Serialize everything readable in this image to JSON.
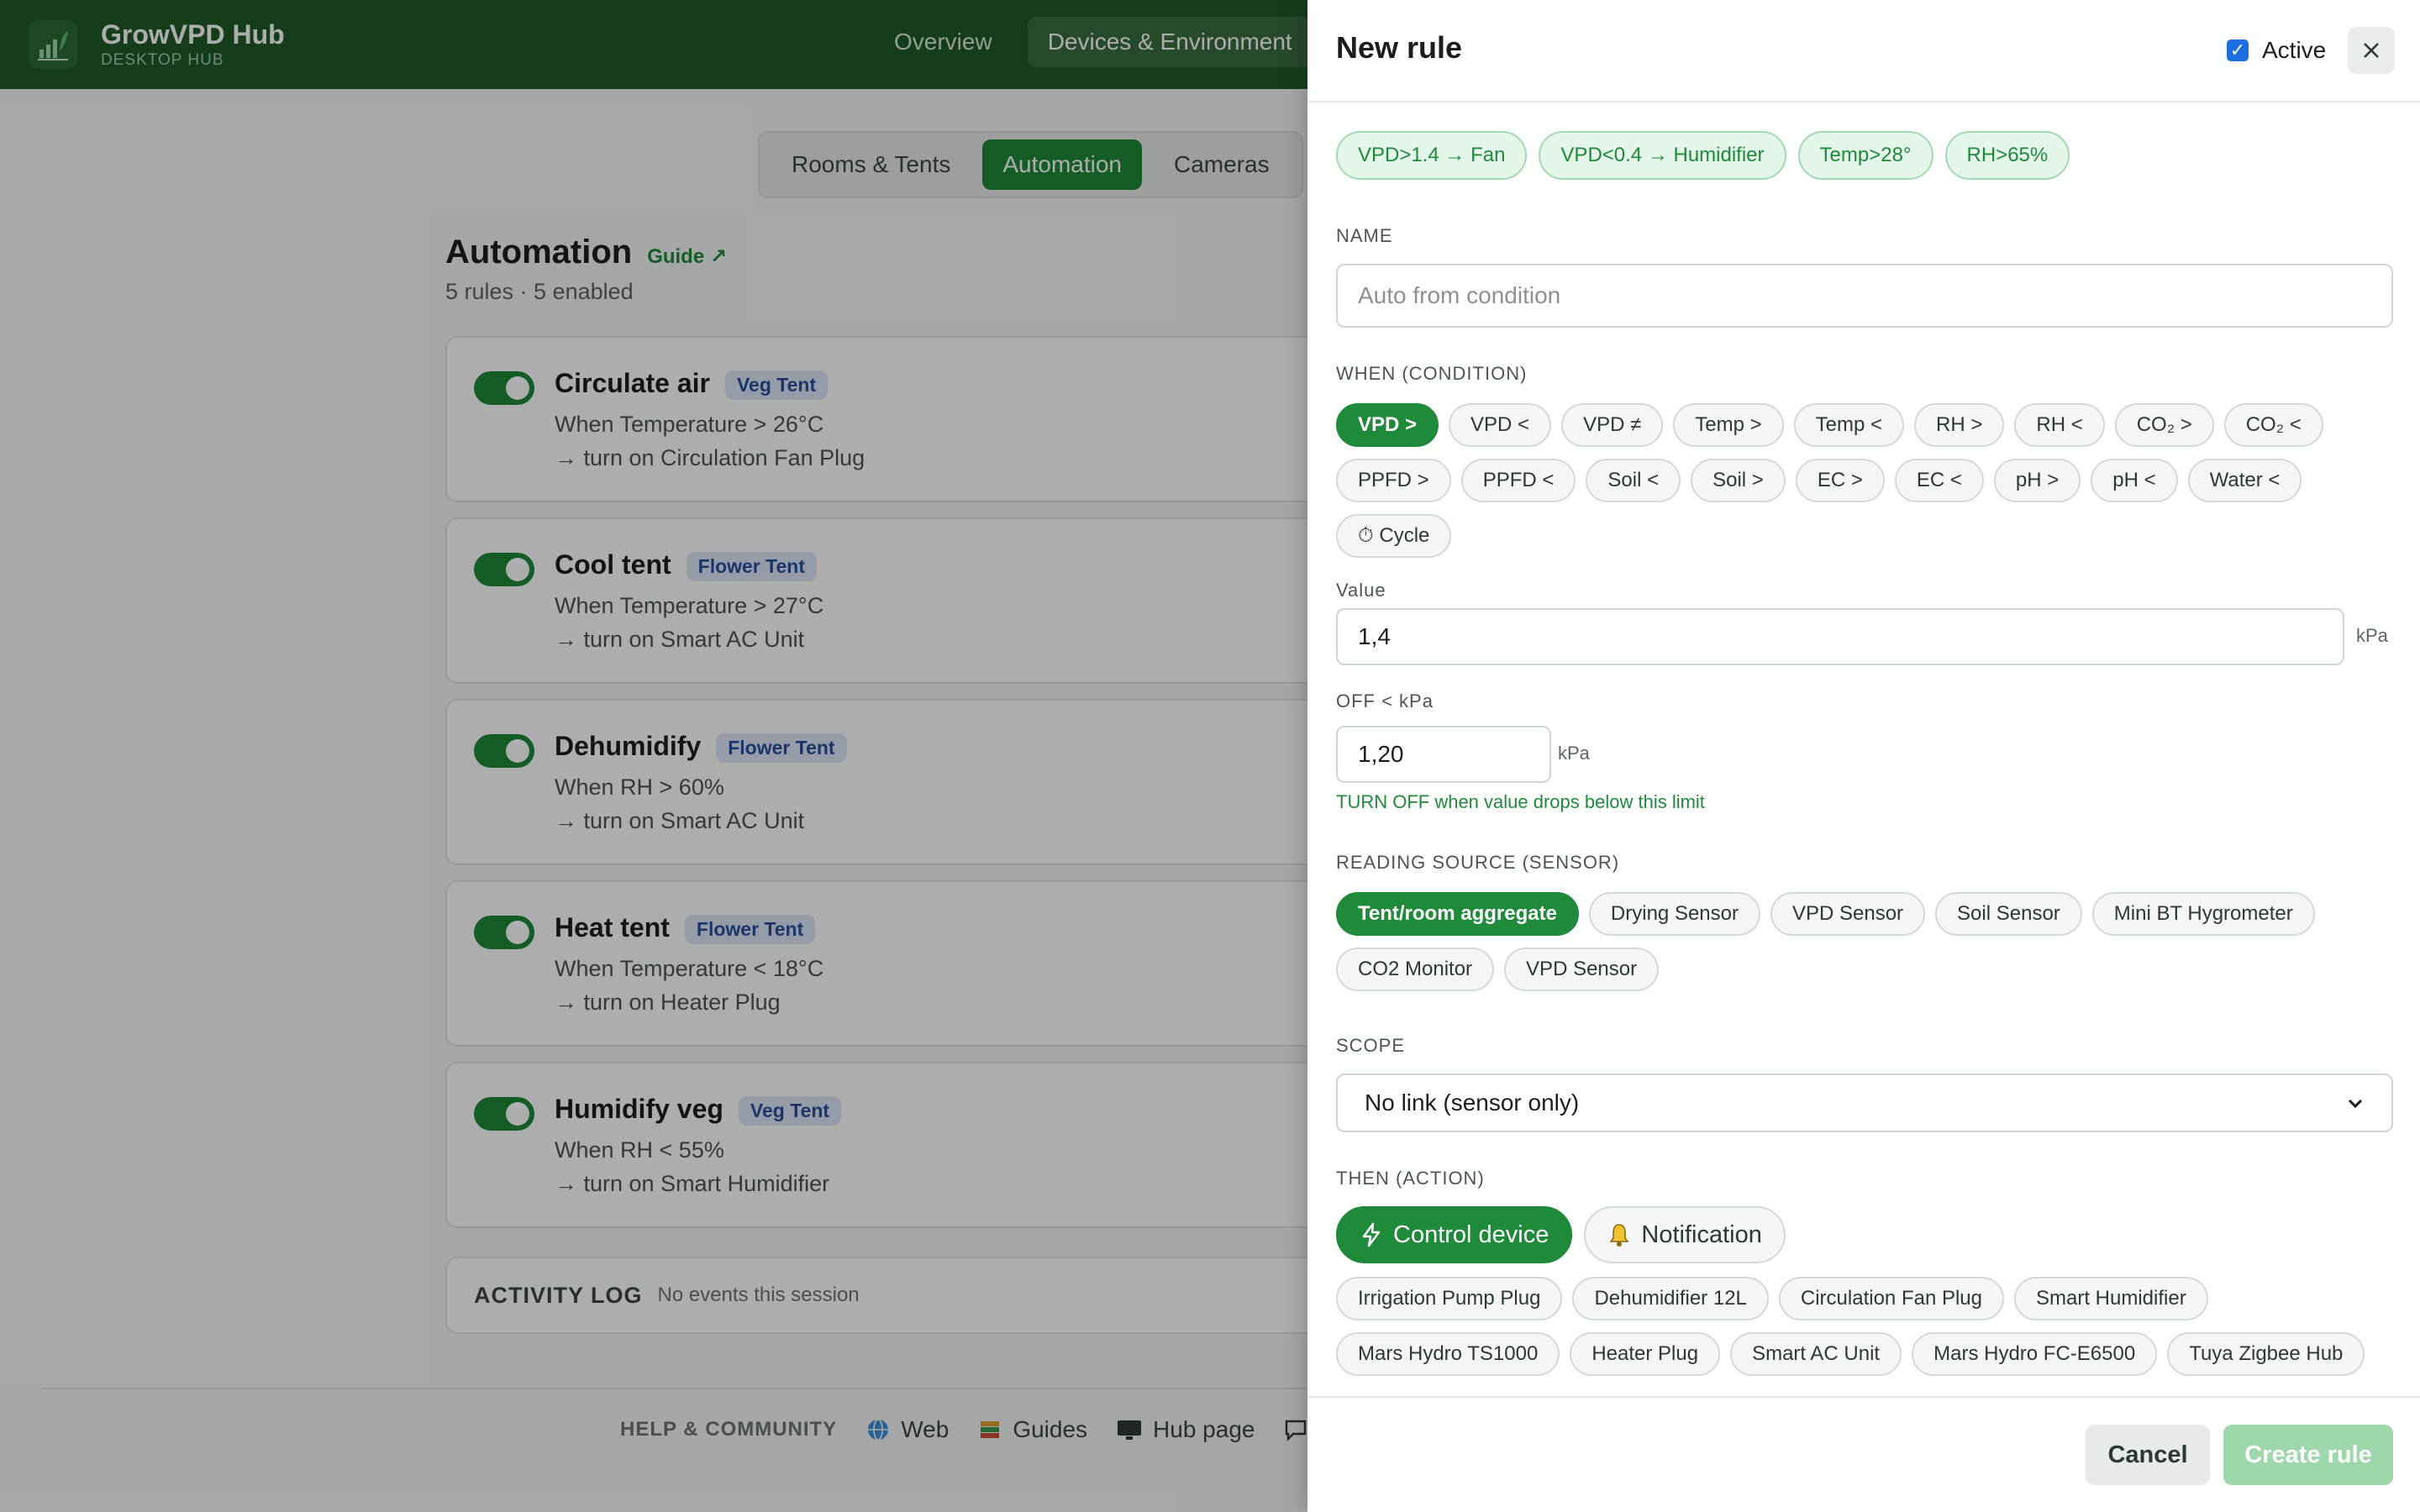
{
  "app": {
    "title": "GrowVPD Hub",
    "subtitle": "DESKTOP HUB"
  },
  "topnav": [
    {
      "label": "Overview"
    },
    {
      "label": "Devices & Environment"
    }
  ],
  "subtabs": [
    {
      "label": "Rooms & Tents"
    },
    {
      "label": "Automation"
    },
    {
      "label": "Cameras"
    }
  ],
  "automation": {
    "title": "Automation",
    "guide": "Guide ↗",
    "summary": "5 rules · 5 enabled",
    "rules": [
      {
        "name": "Circulate air",
        "tag": "Veg Tent",
        "when": "When Temperature > 26°C",
        "then": "→ turn on Circulation Fan Plug"
      },
      {
        "name": "Cool tent",
        "tag": "Flower Tent",
        "when": "When Temperature > 27°C",
        "then": "→ turn on Smart AC Unit"
      },
      {
        "name": "Dehumidify",
        "tag": "Flower Tent",
        "when": "When RH > 60%",
        "then": "→ turn on Smart AC Unit"
      },
      {
        "name": "Heat tent",
        "tag": "Flower Tent",
        "when": "When Temperature < 18°C",
        "then": "→ turn on Heater Plug"
      },
      {
        "name": "Humidify veg",
        "tag": "Veg Tent",
        "when": "When RH < 55%",
        "then": "→ turn on Smart Humidifier"
      }
    ],
    "activity_label": "ACTIVITY LOG",
    "activity_empty": "No events this session"
  },
  "footer": {
    "label": "HELP & COMMUNITY",
    "links": [
      "Web",
      "Guides",
      "Hub page"
    ]
  },
  "panel": {
    "title": "New rule",
    "active_label": "Active",
    "presets": [
      "VPD>1.4 → Fan",
      "VPD<0.4 → Humidifier",
      "Temp>28°",
      "RH>65%"
    ],
    "name_label": "NAME",
    "name_placeholder": "Auto from condition",
    "when_label": "WHEN (CONDITION)",
    "conditions": [
      "VPD >",
      "VPD <",
      "VPD ≠",
      "Temp >",
      "Temp <",
      "RH >",
      "RH <",
      "CO₂ >",
      "CO₂ <",
      "PPFD >",
      "PPFD <",
      "Soil <",
      "Soil >",
      "EC >",
      "EC <",
      "pH >",
      "pH <",
      "Water <",
      "⏱ Cycle"
    ],
    "condition_selected": "VPD >",
    "value_label": "Value",
    "value": "1,4",
    "value_unit": "kPa",
    "off_label": "OFF < kPa",
    "off_value": "1,20",
    "off_unit": "kPa",
    "off_hint": "TURN OFF when value drops below this limit",
    "source_label": "READING SOURCE (SENSOR)",
    "sources": [
      "Tent/room aggregate",
      "Drying Sensor",
      "VPD Sensor",
      "Soil Sensor",
      "Mini BT Hygrometer",
      "CO2 Monitor",
      "VPD Sensor"
    ],
    "scope_label": "SCOPE",
    "scope_value": "No link (sensor only)",
    "then_label": "THEN (ACTION)",
    "actions": [
      {
        "label": "Control device",
        "icon": "lightning-icon"
      },
      {
        "label": "Notification",
        "icon": "bell-icon"
      }
    ],
    "devices": [
      "Irrigation Pump Plug",
      "Dehumidifier 12L",
      "Circulation Fan Plug",
      "Smart Humidifier",
      "Mars Hydro TS1000",
      "Heater Plug",
      "Smart AC Unit",
      "Mars Hydro FC-E6500",
      "Tuya Zigbee Hub"
    ],
    "cancel": "Cancel",
    "create": "Create rule"
  },
  "colors": {
    "brand": "#1f5a2a",
    "accent": "#1f8a3a",
    "tag": "#2a4fa0"
  }
}
